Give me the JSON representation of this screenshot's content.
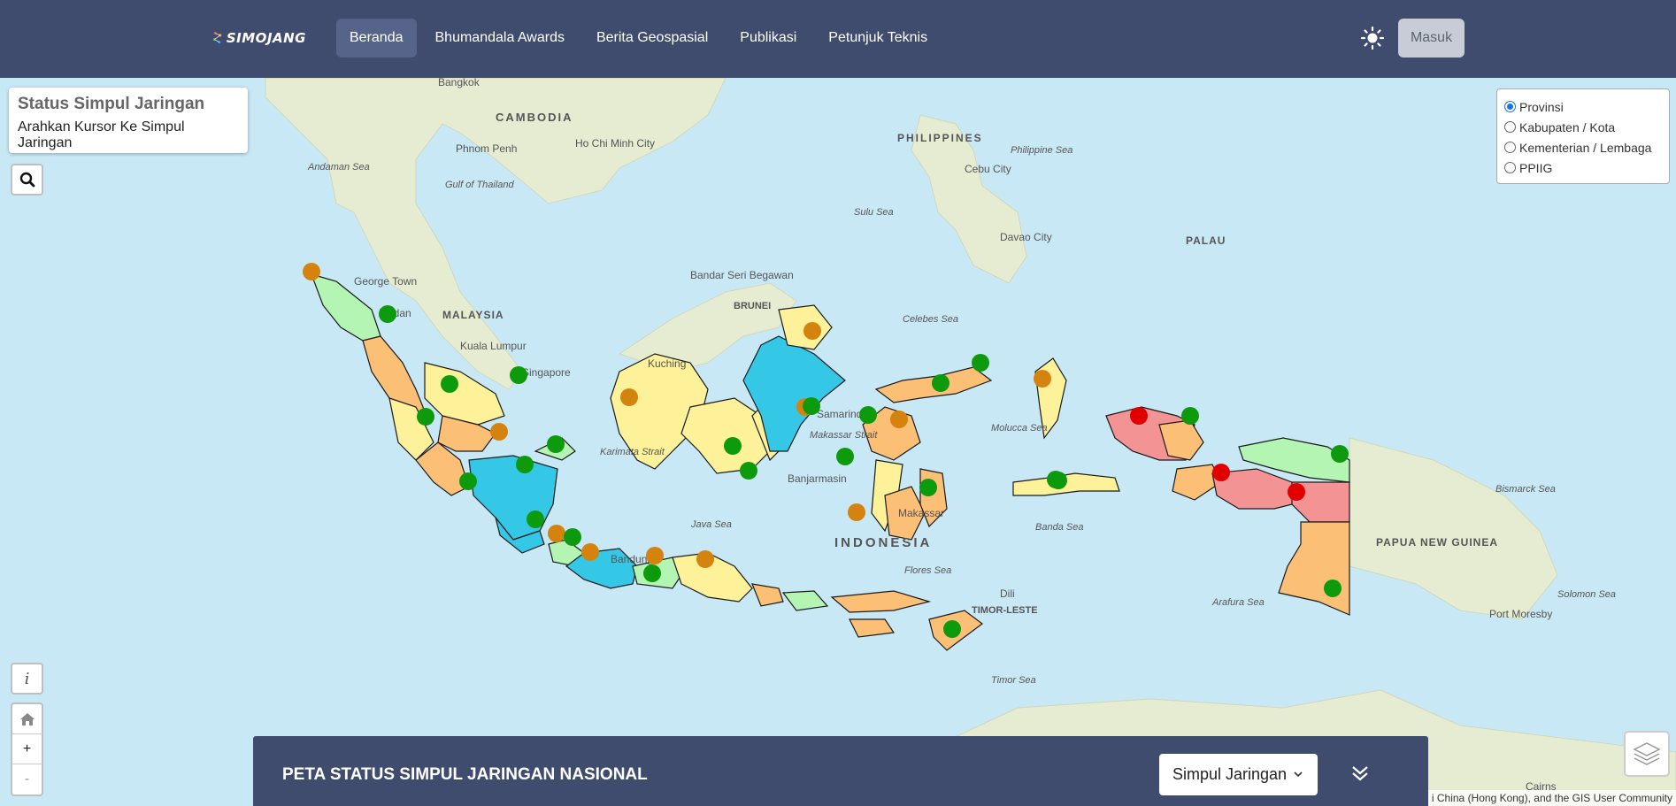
{
  "nav": {
    "logo_text": "SIMOJANG",
    "items": [
      {
        "label": "Beranda",
        "active": true
      },
      {
        "label": "Bhumandala Awards",
        "active": false
      },
      {
        "label": "Berita Geospasial",
        "active": false
      },
      {
        "label": "Publikasi",
        "active": false
      },
      {
        "label": "Petunjuk Teknis",
        "active": false
      }
    ],
    "theme_icon": "sun-icon",
    "login_label": "Masuk"
  },
  "status_panel": {
    "title": "Status Simpul Jaringan",
    "subtitle": "Arahkan Kursor Ke Simpul Jaringan"
  },
  "layer_options": [
    {
      "label": "Provinsi",
      "checked": true
    },
    {
      "label": "Kabupaten / Kota",
      "checked": false
    },
    {
      "label": "Kementerian / Lembaga",
      "checked": false
    },
    {
      "label": "PPIIG",
      "checked": false
    }
  ],
  "controls": {
    "info_label": "i",
    "zoom_in": "+",
    "zoom_out": "-"
  },
  "bottom_bar": {
    "title": "PETA STATUS SIMPUL JARINGAN NASIONAL",
    "select_value": "Simpul Jaringan"
  },
  "attribution": "i China (Hong Kong), and the GIS User Community",
  "map_labels": {
    "countries": [
      "CAMBODIA",
      "PHILIPPINES",
      "MALAYSIA",
      "BRUNEI",
      "PALAU",
      "INDONESIA",
      "TIMOR-LESTE",
      "PAPUA NEW GUINEA"
    ],
    "cities": [
      "Bangkok",
      "Phnom Penh",
      "Ho Chi Minh City",
      "Cebu City",
      "Davao City",
      "George Town",
      "Medan",
      "Kuala Lumpur",
      "Singapore",
      "Kuching",
      "Bandar Seri Begawan",
      "Samarinda",
      "Banjarmasin",
      "Makassar",
      "Bandung",
      "Dili",
      "Port Moresby",
      "Cairns"
    ],
    "seas": [
      "Andaman Sea",
      "Gulf of Thailand",
      "Philippine Sea",
      "Sulu Sea",
      "Celebes Sea",
      "Molucca Sea",
      "Java Sea",
      "Flores Sea",
      "Banda Sea",
      "Arafura Sea",
      "Timor Sea",
      "Bismarck Sea",
      "Solomon Sea",
      "Karimata Strait",
      "Makassar Strait"
    ]
  },
  "legend_colors": {
    "node_active": "#0d9a0d",
    "node_partial": "#d4830f",
    "node_inactive": "#e00000",
    "province_blue": "#35c8e6",
    "province_yellow": "#fdf299",
    "province_orange": "#fbbf76",
    "province_green": "#b4f5b4",
    "province_red": "#f49393"
  },
  "nodes": [
    {
      "status": "partial"
    },
    {
      "status": "active"
    },
    {
      "status": "active"
    },
    {
      "status": "active"
    },
    {
      "status": "active"
    },
    {
      "status": "partial"
    },
    {
      "status": "active"
    },
    {
      "status": "active"
    },
    {
      "status": "active"
    },
    {
      "status": "active"
    },
    {
      "status": "partial"
    },
    {
      "status": "active"
    },
    {
      "status": "partial"
    },
    {
      "status": "partial"
    },
    {
      "status": "active"
    },
    {
      "status": "partial"
    },
    {
      "status": "partial"
    },
    {
      "status": "active"
    },
    {
      "status": "active"
    },
    {
      "status": "partial"
    },
    {
      "status": "active"
    },
    {
      "status": "active"
    },
    {
      "status": "partial"
    },
    {
      "status": "partial"
    },
    {
      "status": "active"
    },
    {
      "status": "active"
    },
    {
      "status": "partial"
    },
    {
      "status": "active"
    },
    {
      "status": "active"
    },
    {
      "status": "partial"
    },
    {
      "status": "active"
    },
    {
      "status": "active"
    },
    {
      "status": "active"
    },
    {
      "status": "inactive"
    },
    {
      "status": "active"
    },
    {
      "status": "inactive"
    },
    {
      "status": "inactive"
    },
    {
      "status": "active"
    },
    {
      "status": "active"
    }
  ]
}
